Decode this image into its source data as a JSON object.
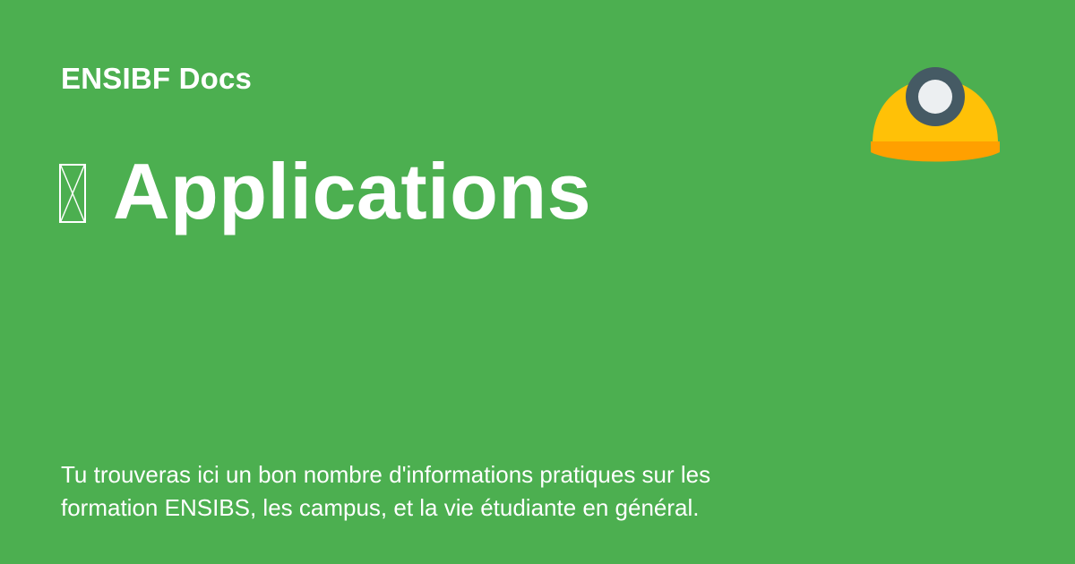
{
  "header": {
    "site_name": "ENSIBF Docs"
  },
  "page": {
    "title": "Applications",
    "title_icon": "missing-glyph-icon",
    "description": "Tu trouveras ici un bon nombre d'informations pratiques sur les formation ENSIBS, les campus, et la vie étudiante en général."
  },
  "logo": {
    "icon": "miner-helmet-icon"
  },
  "colors": {
    "background": "#4caf50",
    "text": "#ffffff",
    "helmet_yellow": "#ffc107",
    "helmet_brim": "#ffa000",
    "lamp_ring": "#455a64",
    "lamp_light": "#eceff1"
  }
}
